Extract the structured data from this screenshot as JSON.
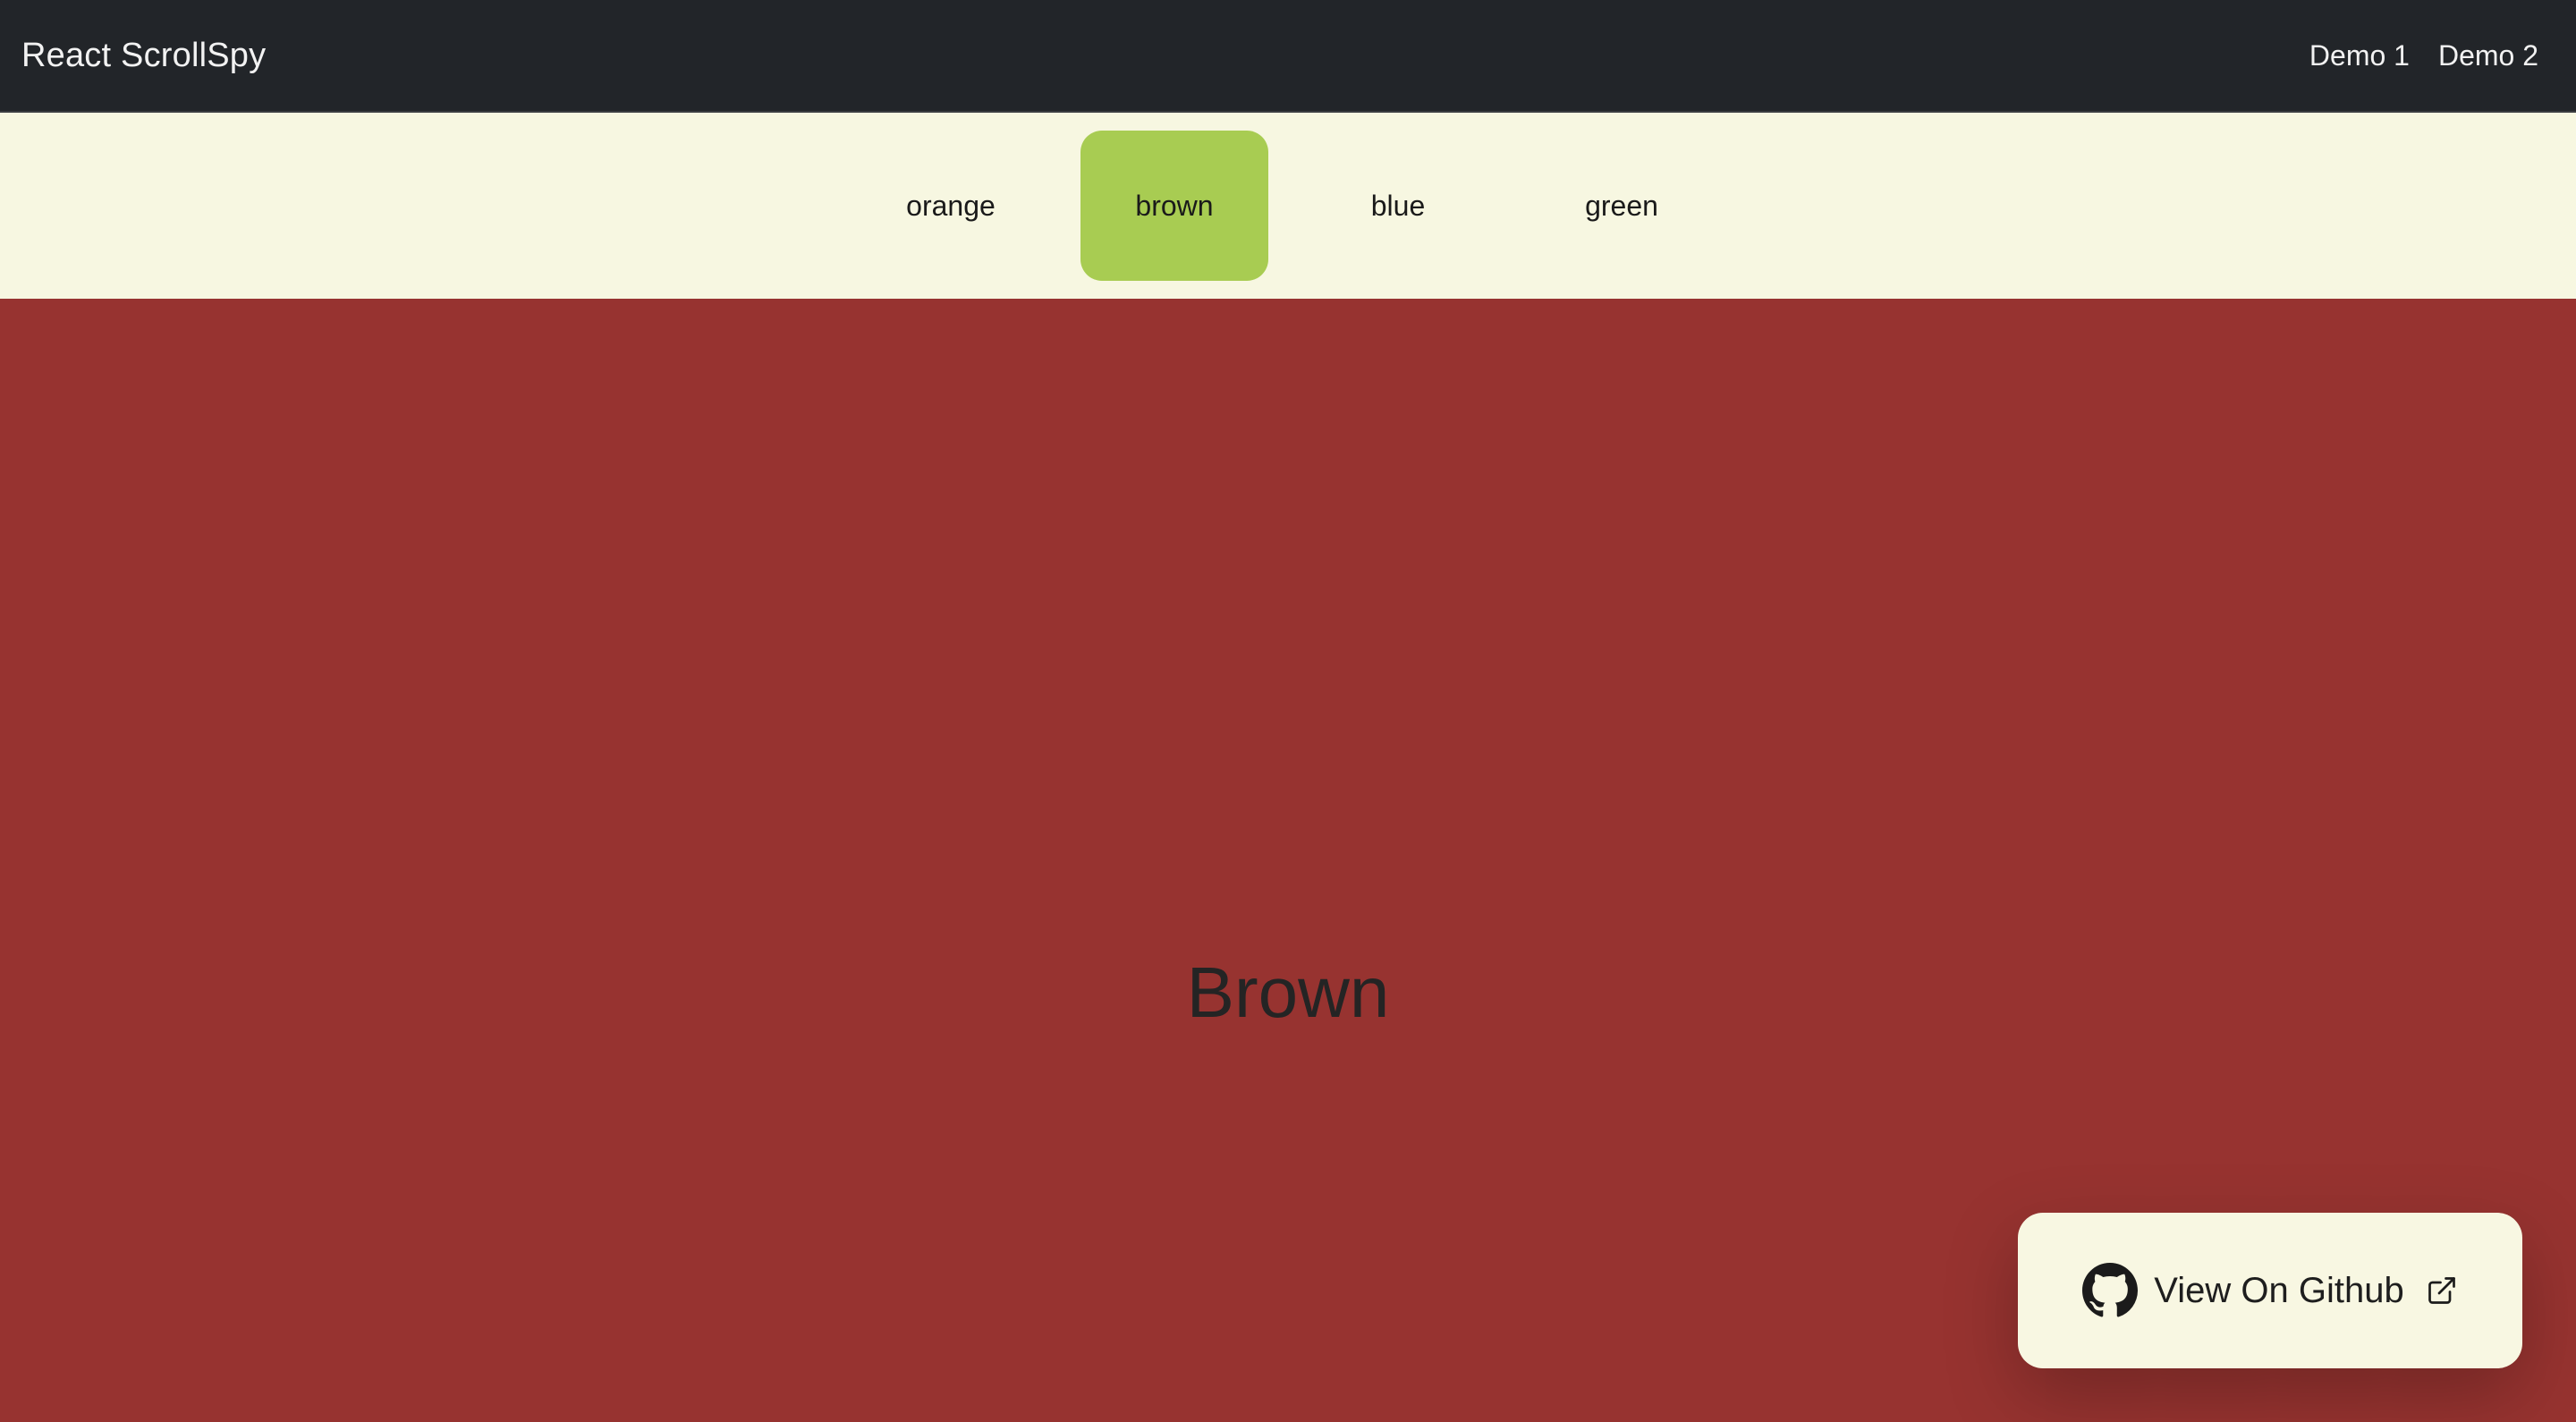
{
  "header": {
    "brand": "React ScrollSpy",
    "links": [
      {
        "label": "Demo 1"
      },
      {
        "label": "Demo 2"
      }
    ]
  },
  "spy_nav": {
    "items": [
      {
        "label": "orange",
        "active": false
      },
      {
        "label": "brown",
        "active": true
      },
      {
        "label": "blue",
        "active": false
      },
      {
        "label": "green",
        "active": false
      }
    ]
  },
  "section": {
    "title": "Brown",
    "background": "#973330"
  },
  "github_card": {
    "label": "View On Github",
    "icon": "github-icon",
    "trailing_icon": "external-link-icon"
  },
  "colors": {
    "header_bg": "#222529",
    "nav_bg": "#f7f7e1",
    "active_item_bg": "#a8cc52",
    "card_bg": "#f8f7e2"
  }
}
